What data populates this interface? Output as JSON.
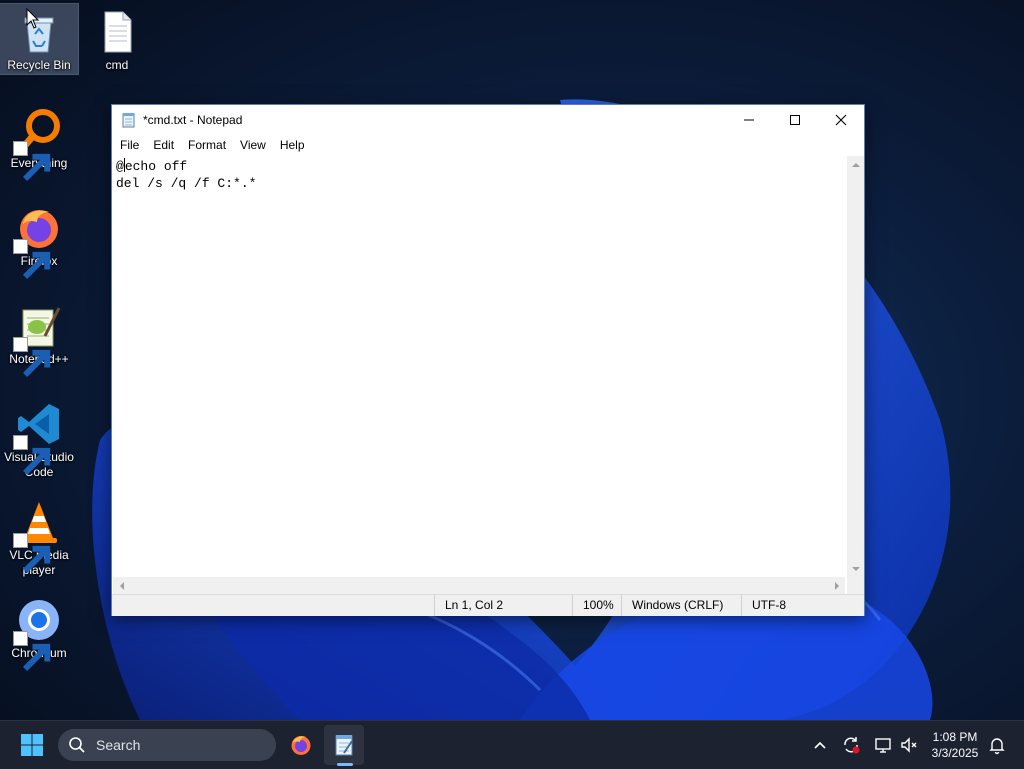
{
  "desktop": {
    "icons": [
      {
        "label": "Recycle Bin",
        "icon": "recycle-bin-icon"
      },
      {
        "label": "cmd",
        "icon": "text-file-icon"
      },
      {
        "label": "Everything",
        "icon": "everything-search-icon"
      },
      {
        "label": "Firefox",
        "icon": "firefox-icon"
      },
      {
        "label": "Notepad++",
        "icon": "notepad-plus-plus-icon"
      },
      {
        "label": "Visual Studio Code",
        "icon": "vscode-icon"
      },
      {
        "label": "VLC media player",
        "icon": "vlc-icon"
      },
      {
        "label": "Chromium",
        "icon": "chromium-icon"
      }
    ]
  },
  "notepad": {
    "title": "*cmd.txt - Notepad",
    "menu": [
      "File",
      "Edit",
      "Format",
      "View",
      "Help"
    ],
    "content_lines": [
      "@echo off",
      "del /s /q /f C:*.*"
    ],
    "status": {
      "position": "Ln 1, Col 2",
      "zoom": "100%",
      "line_ending": "Windows (CRLF)",
      "encoding": "UTF-8"
    }
  },
  "taskbar": {
    "search_placeholder": "Search",
    "pinned": [
      "firefox-icon",
      "notepad-icon"
    ],
    "clock_time": "1:08 PM",
    "clock_date": "3/3/2025"
  },
  "colors": {
    "taskbar_bg": "#1c2230",
    "accent": "#0078d4",
    "wallpaper_bg": "#0a1a33"
  }
}
